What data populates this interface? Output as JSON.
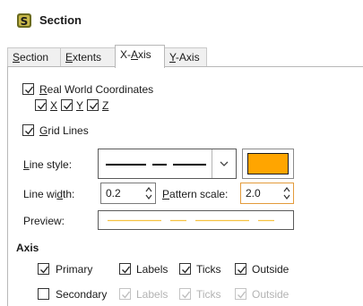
{
  "window": {
    "title": "Section",
    "icon": "section-app-icon"
  },
  "tabs": [
    {
      "label_pre": "",
      "label_u": "S",
      "label_post": "ection",
      "active": false
    },
    {
      "label_pre": "",
      "label_u": "E",
      "label_post": "xtents",
      "active": false
    },
    {
      "label_pre": "X-",
      "label_u": "A",
      "label_post": "xis",
      "active": true
    },
    {
      "label_pre": "",
      "label_u": "Y",
      "label_post": "-Axis",
      "active": false
    }
  ],
  "real_world": {
    "label_u": "R",
    "label_post": "eal World Coordinates",
    "checked": true,
    "x": {
      "label": "X",
      "checked": true
    },
    "y": {
      "label": "Y",
      "checked": true
    },
    "z": {
      "label": "Z",
      "checked": true
    }
  },
  "grid_lines": {
    "label_u": "G",
    "label_post": "rid Lines",
    "checked": true,
    "line_style": {
      "label_u": "L",
      "label_post": "ine style:"
    },
    "color": "#ffa500",
    "line_width": {
      "label_pre": "Line wi",
      "label_u": "d",
      "label_post": "th:",
      "value": "0.2"
    },
    "pattern_scale": {
      "label_u": "P",
      "label_post": "attern scale:",
      "value": "2.0"
    },
    "preview_label": "Preview:"
  },
  "axis": {
    "title": "Axis",
    "primary": {
      "label": "Primary",
      "checked": true,
      "labels": "Labels",
      "ticks": "Ticks",
      "outside": "Outside"
    },
    "secondary": {
      "label": "Secondary",
      "checked": false,
      "labels": "Labels",
      "ticks": "Ticks",
      "outside": "Outside"
    }
  }
}
